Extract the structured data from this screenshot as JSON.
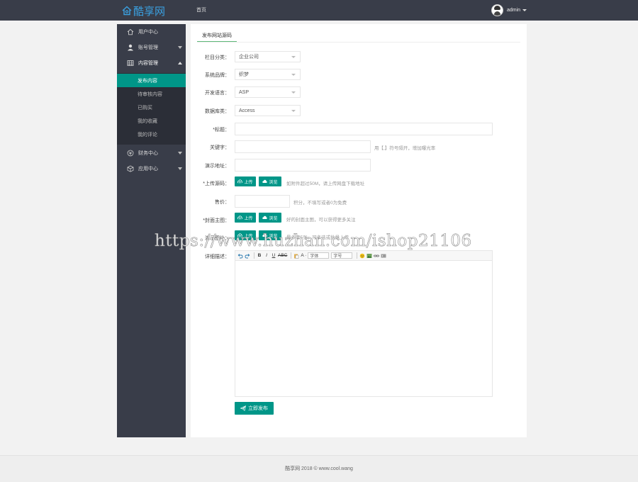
{
  "header": {
    "logo_text": "酷享网",
    "nav_home": "首页",
    "user_name": "admin"
  },
  "sidebar": {
    "items": [
      {
        "label": "用户中心",
        "icon": "home-icon"
      },
      {
        "label": "账号管理",
        "icon": "user-icon"
      },
      {
        "label": "内容管理",
        "icon": "grid-icon"
      },
      {
        "label": "财务中心",
        "icon": "finance-icon"
      },
      {
        "label": "应用中心",
        "icon": "cube-icon"
      }
    ],
    "sub_items": [
      {
        "label": "发布内容",
        "active": true
      },
      {
        "label": "待审核内容"
      },
      {
        "label": "已购买"
      },
      {
        "label": "我的收藏"
      },
      {
        "label": "我的评论"
      }
    ]
  },
  "tab": {
    "label": "发布网站源码"
  },
  "form": {
    "category_label": "栏目分类：",
    "category_value": "企业公司",
    "system_label": "系统品牌：",
    "system_value": "织梦",
    "language_label": "开发语言：",
    "language_value": "ASP",
    "database_label": "数据库类：",
    "database_value": "Access",
    "title_label": "*标题：",
    "keywords_label": "关键字：",
    "keywords_hint": "用【,】符号隔开，增加曝光率",
    "demo_label": "演示地址：",
    "upload_label": "*上传源码：",
    "upload_button": "上传",
    "browse_button": "浏览",
    "upload_hint": "如附件超过50M，请上传网盘下载地址",
    "price_label": "售价：",
    "price_hint": "积分，不填写或者0为免费",
    "cover_label": "*封面主图：",
    "cover_hint": "好的封面主图，可以获得更多关注",
    "demo_images_label": "演示图片：",
    "demo_images_hint": "最多传5张，可多选或批量上传",
    "details_label": "详细描述：",
    "submit_label": "立即发布"
  },
  "editor": {
    "font_select": "字体",
    "size_select": "字号"
  },
  "footer": {
    "text": "酷享网  2018 © www.cool.wang"
  },
  "watermark": {
    "text": "https://www.huzhan.com/ishop21106"
  },
  "colors": {
    "topbar": "#393d49",
    "accent": "#009688",
    "logo": "#3aa0e0"
  }
}
